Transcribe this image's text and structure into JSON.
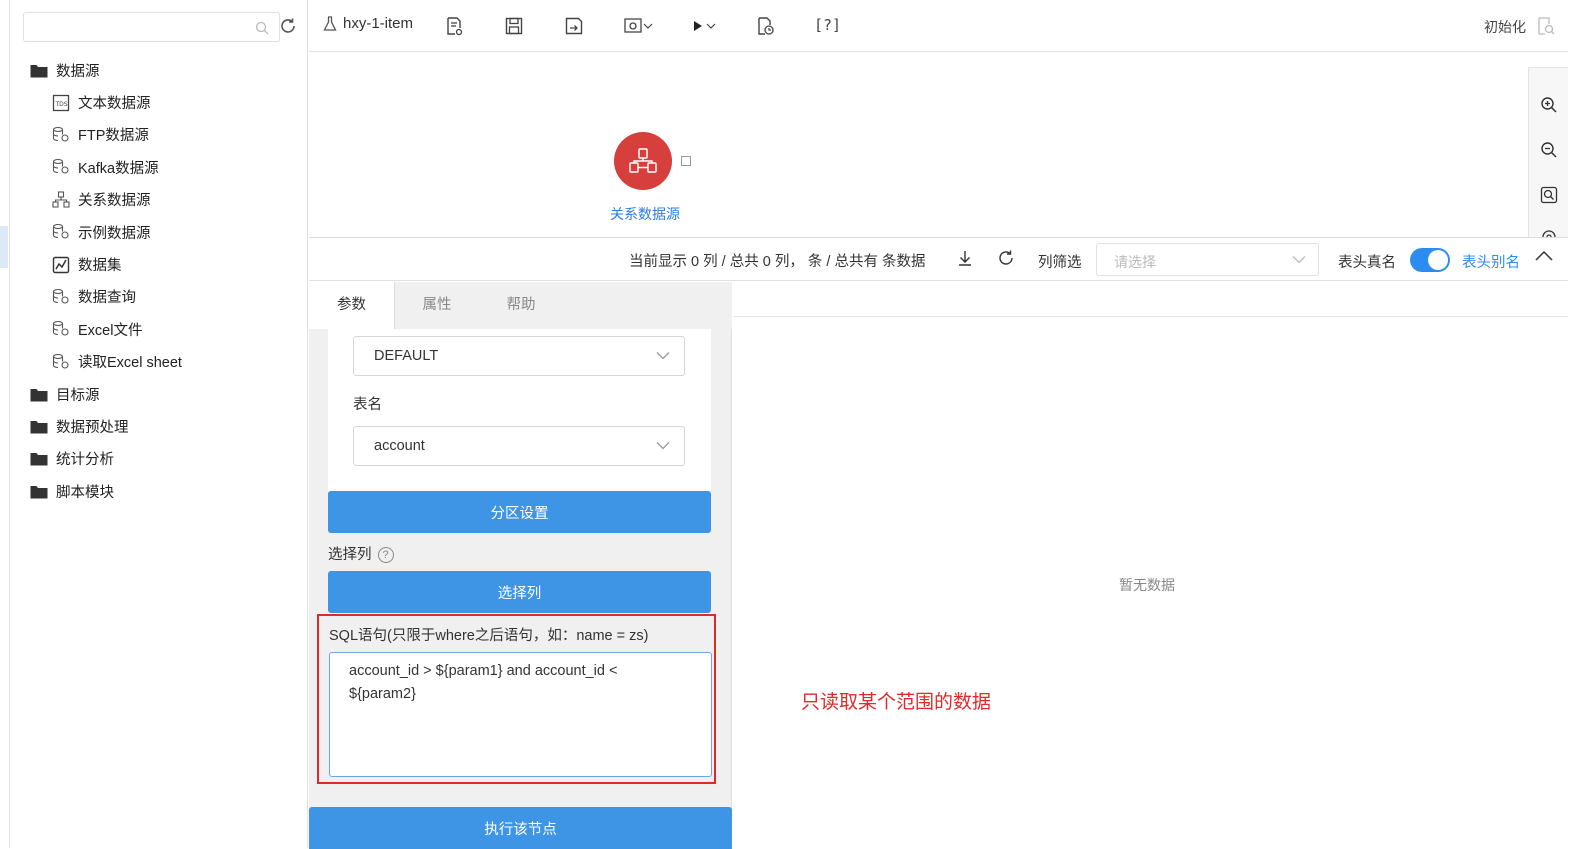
{
  "sidebar": {
    "search_placeholder": "",
    "tree": [
      {
        "label": "数据源",
        "type": "folder",
        "icon": "folder-icon"
      },
      {
        "label": "文本数据源",
        "type": "child",
        "icon": "text-file-icon"
      },
      {
        "label": "FTP数据源",
        "type": "child",
        "icon": "database-icon"
      },
      {
        "label": "Kafka数据源",
        "type": "child",
        "icon": "database-icon"
      },
      {
        "label": "关系数据源",
        "type": "child",
        "icon": "relation-icon"
      },
      {
        "label": "示例数据源",
        "type": "child",
        "icon": "database-icon"
      },
      {
        "label": "数据集",
        "type": "child",
        "icon": "dataset-icon"
      },
      {
        "label": "数据查询",
        "type": "child",
        "icon": "database-icon"
      },
      {
        "label": "Excel文件",
        "type": "child",
        "icon": "database-icon"
      },
      {
        "label": "读取Excel sheet",
        "type": "child",
        "icon": "database-icon"
      },
      {
        "label": "目标源",
        "type": "folder",
        "icon": "folder-icon"
      },
      {
        "label": "数据预处理",
        "type": "folder",
        "icon": "folder-icon"
      },
      {
        "label": "统计分析",
        "type": "folder",
        "icon": "folder-icon"
      },
      {
        "label": "脚本模块",
        "type": "folder",
        "icon": "folder-icon"
      }
    ]
  },
  "toolbar": {
    "project_name": "hxy-1-item",
    "help_label": "[?]",
    "init_label": "初始化"
  },
  "canvas": {
    "node_label": "关系数据源",
    "node_color": "#d63f3c"
  },
  "databar": {
    "count_text": "当前显示 0 列 / 总共 0 列， 条 / 总共有 条数据",
    "filter_label": "列筛选",
    "filter_placeholder": "请选择",
    "real_name_label": "表头真名",
    "alias_label": "表头别名"
  },
  "panel": {
    "tabs": [
      "参数",
      "属性",
      "帮助"
    ],
    "schema_value": "DEFAULT",
    "table_label": "表名",
    "table_value": "account",
    "partition_button": "分区设置",
    "select_columns_label": "选择列",
    "help_glyph": "?",
    "select_columns_button": "选择列",
    "sql_label": "SQL语句(只限于where之后语句，如：name = zs)",
    "sql_value": "account_id > ${param1} and account_id <\n${param2}",
    "exec_button": "执行该节点"
  },
  "result": {
    "empty_text": "暂无数据"
  },
  "annotation": {
    "text": "只读取某个范围的数据",
    "color": "#e02a2a"
  }
}
